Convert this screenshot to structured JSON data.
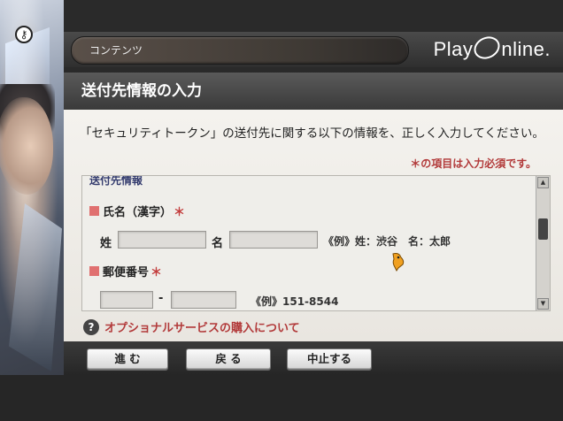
{
  "header": {
    "tab_label": "コンテンツ",
    "logo_left": "Play",
    "logo_right": "nline."
  },
  "page": {
    "title": "送付先情報の入力",
    "intro": "「セキュリティトークン」の送付先に関する以下の情報を、正しく入力してください。",
    "required_note": "＊の項目は入力必須です。"
  },
  "form": {
    "section_title": "送付先情報",
    "name_field": {
      "label": "氏名（漢字）",
      "required_mark": "＊",
      "last_label": "姓",
      "first_label": "名",
      "last_value": "",
      "first_value": "",
      "example": "《例》姓：渋谷　名：太郎"
    },
    "postal_field": {
      "label": "郵便番号",
      "required_mark": "＊",
      "part1_value": "",
      "part2_value": "",
      "separator": "-",
      "example": "《例》151-8544"
    }
  },
  "help": {
    "icon_glyph": "?",
    "text": "オプショナルサービスの購入について"
  },
  "buttons": {
    "next": "進 む",
    "back": "戻 る",
    "cancel": "中止する"
  },
  "colors": {
    "required": "#c23a3a",
    "section_title": "#333b6e"
  }
}
